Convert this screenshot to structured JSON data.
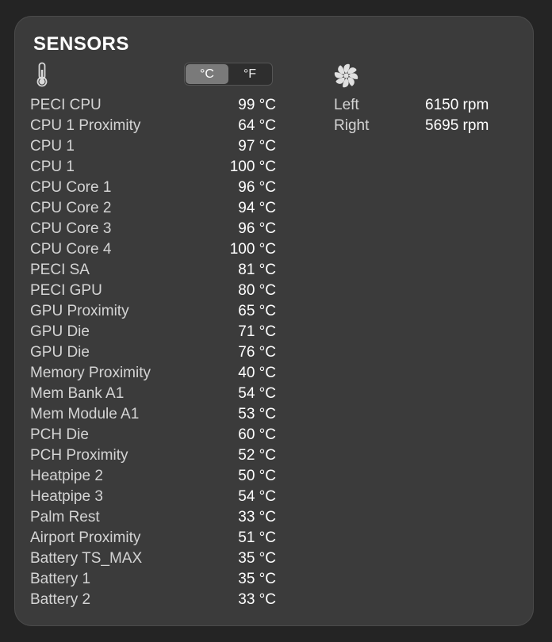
{
  "title": "SENSORS",
  "icons": {
    "temperature": "thermometer-icon",
    "fans": "fan-icon"
  },
  "unit_toggle": {
    "options": [
      "°C",
      "°F"
    ],
    "selected": "°C"
  },
  "sensors": [
    {
      "name": "PECI CPU",
      "value": "99 °C"
    },
    {
      "name": "CPU 1 Proximity",
      "value": "64 °C"
    },
    {
      "name": "CPU 1",
      "value": "97 °C"
    },
    {
      "name": "CPU 1",
      "value": "100 °C"
    },
    {
      "name": "CPU Core 1",
      "value": "96 °C"
    },
    {
      "name": "CPU Core 2",
      "value": "94 °C"
    },
    {
      "name": "CPU Core 3",
      "value": "96 °C"
    },
    {
      "name": "CPU Core 4",
      "value": "100 °C"
    },
    {
      "name": "PECI SA",
      "value": "81 °C"
    },
    {
      "name": "PECI GPU",
      "value": "80 °C"
    },
    {
      "name": "GPU Proximity",
      "value": "65 °C"
    },
    {
      "name": "GPU Die",
      "value": "71 °C"
    },
    {
      "name": "GPU Die",
      "value": "76 °C"
    },
    {
      "name": "Memory Proximity",
      "value": "40 °C"
    },
    {
      "name": "Mem Bank A1",
      "value": "54 °C"
    },
    {
      "name": "Mem Module A1",
      "value": "53 °C"
    },
    {
      "name": "PCH Die",
      "value": "60 °C"
    },
    {
      "name": "PCH Proximity",
      "value": "52 °C"
    },
    {
      "name": "Heatpipe 2",
      "value": "50 °C"
    },
    {
      "name": "Heatpipe 3",
      "value": "54 °C"
    },
    {
      "name": "Palm Rest",
      "value": "33 °C"
    },
    {
      "name": "Airport Proximity",
      "value": "51 °C"
    },
    {
      "name": "Battery TS_MAX",
      "value": "35 °C"
    },
    {
      "name": "Battery 1",
      "value": "35 °C"
    },
    {
      "name": "Battery 2",
      "value": "33 °C"
    }
  ],
  "fans": [
    {
      "name": "Left",
      "speed": "6150 rpm"
    },
    {
      "name": "Right",
      "speed": "5695 rpm"
    }
  ]
}
